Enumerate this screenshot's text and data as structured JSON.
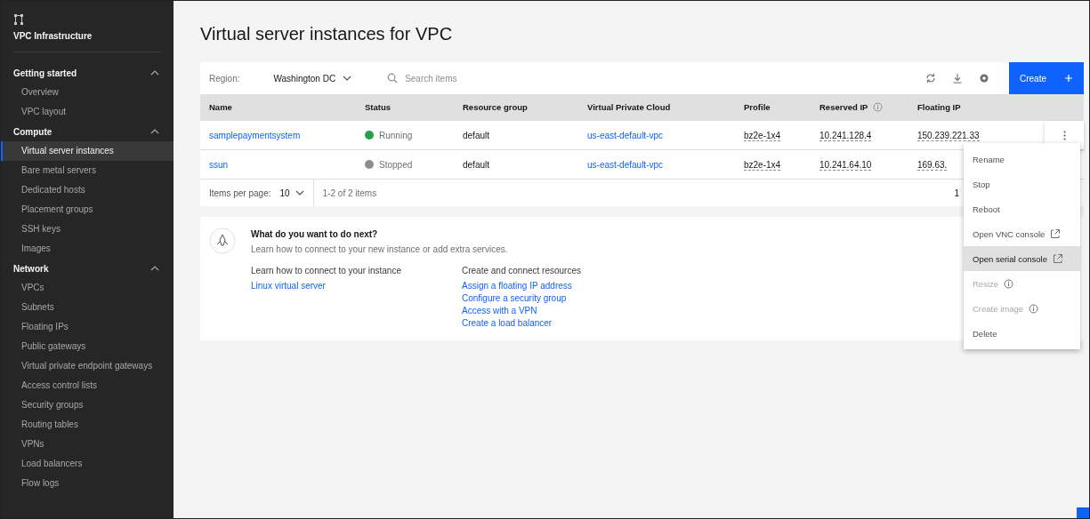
{
  "sidebar": {
    "title": "VPC Infrastructure",
    "sections": [
      {
        "label": "Getting started",
        "expanded": true,
        "items": [
          {
            "label": "Overview",
            "selected": false
          },
          {
            "label": "VPC layout",
            "selected": false
          }
        ]
      },
      {
        "label": "Compute",
        "expanded": true,
        "items": [
          {
            "label": "Virtual server instances",
            "selected": true
          },
          {
            "label": "Bare metal servers",
            "selected": false
          },
          {
            "label": "Dedicated hosts",
            "selected": false
          },
          {
            "label": "Placement groups",
            "selected": false
          },
          {
            "label": "SSH keys",
            "selected": false
          },
          {
            "label": "Images",
            "selected": false
          }
        ]
      },
      {
        "label": "Network",
        "expanded": true,
        "items": [
          {
            "label": "VPCs",
            "selected": false
          },
          {
            "label": "Subnets",
            "selected": false
          },
          {
            "label": "Floating IPs",
            "selected": false
          },
          {
            "label": "Public gateways",
            "selected": false
          },
          {
            "label": "Virtual private endpoint gateways",
            "selected": false
          },
          {
            "label": "Access control lists",
            "selected": false
          },
          {
            "label": "Security groups",
            "selected": false
          },
          {
            "label": "Routing tables",
            "selected": false
          },
          {
            "label": "VPNs",
            "selected": false
          },
          {
            "label": "Load balancers",
            "selected": false
          },
          {
            "label": "Flow logs",
            "selected": false
          }
        ]
      }
    ]
  },
  "page_title": "Virtual server instances for VPC",
  "toolbar": {
    "region_label": "Region:",
    "region_value": "Washington DC",
    "search": {
      "placeholder": "Search items"
    },
    "create_button": "Create"
  },
  "table": {
    "columns": [
      {
        "label": "Name",
        "info": false
      },
      {
        "label": "Status",
        "info": false
      },
      {
        "label": "Resource group",
        "info": false
      },
      {
        "label": "Virtual Private Cloud",
        "info": false
      },
      {
        "label": "Profile",
        "info": false
      },
      {
        "label": "Reserved IP",
        "info": true
      },
      {
        "label": "Floating IP",
        "info": false
      }
    ],
    "rows": [
      {
        "name": "samplepaymentsystem",
        "status": "Running",
        "color": "#24a148",
        "resource_group": "default",
        "vpc": "us-east-default-vpc",
        "profile": "bz2e-1x4",
        "reserved_ip": "10.241.128.4",
        "floating_ip": "150.239.221.33",
        "menu_open": true
      },
      {
        "name": "ssun",
        "status": "Stopped",
        "color": "#8d8d8d",
        "resource_group": "default",
        "vpc": "us-east-default-vpc",
        "profile": "bz2e-1x4",
        "reserved_ip": "10.241.64.10",
        "floating_ip": "169.63.",
        "menu_open": false
      }
    ]
  },
  "pagination": {
    "items_per_page_label": "Items per page:",
    "items_per_page": "10",
    "range": "1-2 of 2 items",
    "page": "1"
  },
  "next_steps": {
    "title": "What do you want to do next?",
    "subtitle": "Learn how to connect to your new instance or add extra services.",
    "groups": [
      {
        "heading": "Learn how to connect to your instance",
        "links": [
          "Linux virtual server"
        ]
      },
      {
        "heading": "Create and connect resources",
        "links": [
          "Assign a floating IP address",
          "Configure a security group",
          "Access with a VPN",
          "Create a load balancer"
        ]
      }
    ]
  },
  "overflow_menu": [
    {
      "label": "Rename",
      "kind": "plain",
      "disabled": false,
      "highlighted": false
    },
    {
      "label": "Stop",
      "kind": "plain",
      "disabled": false,
      "highlighted": false
    },
    {
      "label": "Reboot",
      "kind": "plain",
      "disabled": false,
      "highlighted": false
    },
    {
      "label": "Open VNC console",
      "kind": "external",
      "disabled": false,
      "highlighted": false
    },
    {
      "label": "Open serial console",
      "kind": "external",
      "disabled": false,
      "highlighted": true
    },
    {
      "label": "Resize",
      "kind": "info",
      "disabled": true,
      "highlighted": false
    },
    {
      "label": "Create image",
      "kind": "info",
      "disabled": true,
      "highlighted": false
    },
    {
      "label": "Delete",
      "kind": "plain",
      "disabled": false,
      "highlighted": false
    }
  ]
}
